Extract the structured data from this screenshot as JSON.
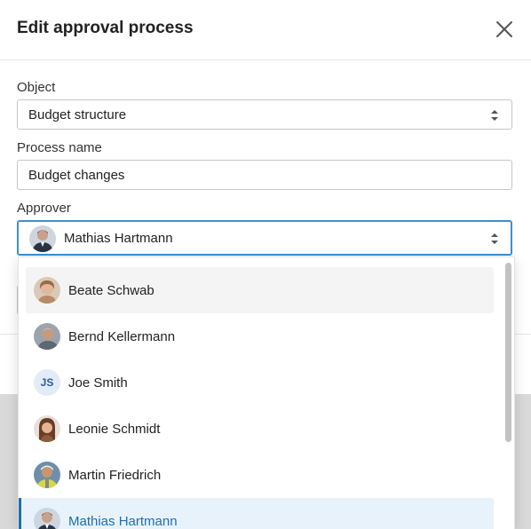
{
  "dialog": {
    "title": "Edit approval process"
  },
  "form": {
    "object": {
      "label": "Object",
      "value": "Budget structure"
    },
    "process_name": {
      "label": "Process name",
      "value": "Budget changes"
    },
    "approver": {
      "label": "Approver",
      "value": "Mathias Hartmann"
    }
  },
  "dropdown": {
    "items": [
      {
        "name": "Beate Schwab",
        "state": "hover",
        "avatar": "photo"
      },
      {
        "name": "Bernd Kellermann",
        "state": "",
        "avatar": "photo"
      },
      {
        "name": "Joe Smith",
        "state": "",
        "avatar": "initials",
        "initials": "JS"
      },
      {
        "name": "Leonie Schmidt",
        "state": "",
        "avatar": "photo"
      },
      {
        "name": "Martin Friedrich",
        "state": "",
        "avatar": "photo"
      },
      {
        "name": "Mathias Hartmann",
        "state": "selected",
        "avatar": "photo"
      }
    ]
  },
  "colors": {
    "accent": "#1f6fae",
    "focus_border": "#3d8fd1",
    "selected_bg": "#e7f2fb",
    "hover_bg": "#f4f4f4"
  }
}
